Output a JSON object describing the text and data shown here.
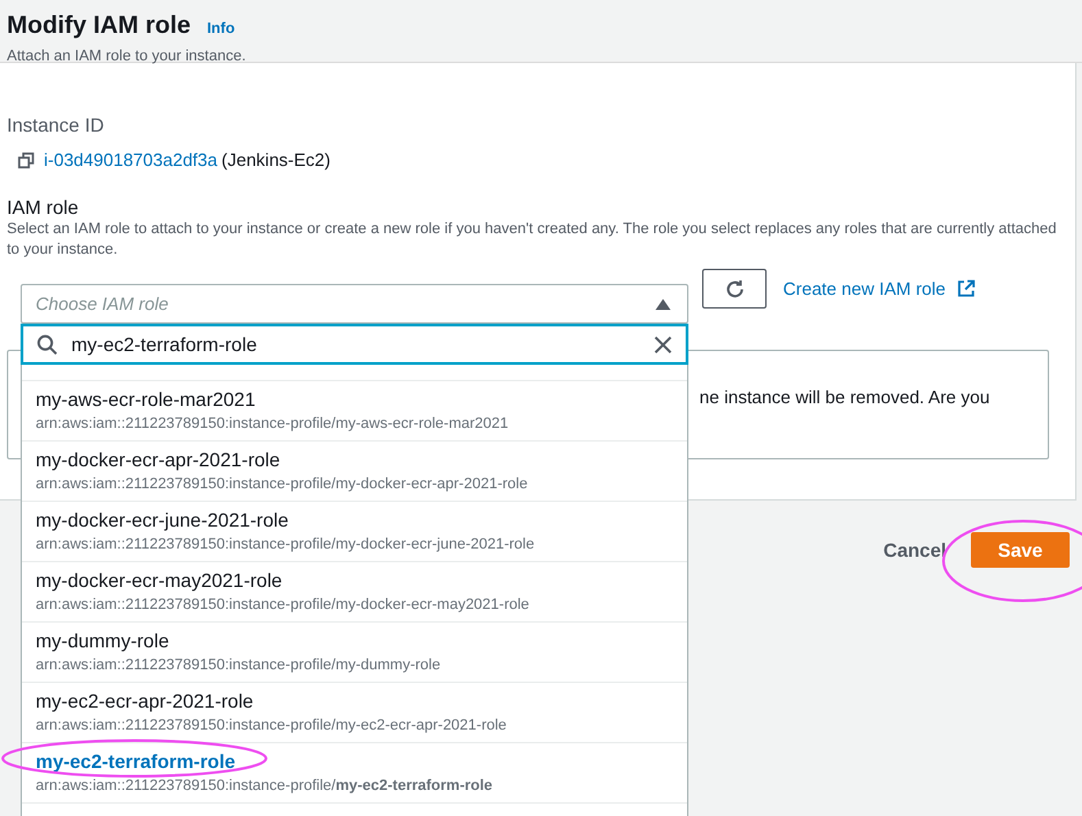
{
  "header": {
    "title": "Modify IAM role",
    "info_link": "Info",
    "subtitle": "Attach an IAM role to your instance."
  },
  "instance": {
    "label": "Instance ID",
    "id": "i-03d49018703a2df3a",
    "name": "(Jenkins-Ec2)"
  },
  "iam_role": {
    "label": "IAM role",
    "description": "Select an IAM role to attach to your instance or create a new role if you haven't created any. The role you select replaces any roles that are currently attached to your instance.",
    "select": {
      "placeholder": "Choose IAM role",
      "expanded": true
    },
    "create_link": "Create new IAM role",
    "search": {
      "value": "my-ec2-terraform-role"
    },
    "options": [
      {
        "name": "my-aws-ecr-role-mar2021",
        "arn": "arn:aws:iam::211223789150:instance-profile/my-aws-ecr-role-mar2021",
        "selected": false
      },
      {
        "name": "my-docker-ecr-apr-2021-role",
        "arn": "arn:aws:iam::211223789150:instance-profile/my-docker-ecr-apr-2021-role",
        "selected": false
      },
      {
        "name": "my-docker-ecr-june-2021-role",
        "arn": "arn:aws:iam::211223789150:instance-profile/my-docker-ecr-june-2021-role",
        "selected": false
      },
      {
        "name": "my-docker-ecr-may2021-role",
        "arn": "arn:aws:iam::211223789150:instance-profile/my-docker-ecr-may2021-role",
        "selected": false
      },
      {
        "name": "my-dummy-role",
        "arn": "arn:aws:iam::211223789150:instance-profile/my-dummy-role",
        "selected": false
      },
      {
        "name": "my-ec2-ecr-apr-2021-role",
        "arn": "arn:aws:iam::211223789150:instance-profile/my-ec2-ecr-apr-2021-role",
        "selected": false
      },
      {
        "name": "my-ec2-terraform-role",
        "arn": "arn:aws:iam::211223789150:instance-profile/**my-ec2-terraform-role**",
        "selected": true
      }
    ]
  },
  "warning": {
    "text": "ne instance will be removed. Are you"
  },
  "footer": {
    "buttons": [
      {
        "label": "Cancel",
        "kind": "link"
      },
      {
        "label": "Save",
        "kind": "primary"
      }
    ]
  }
}
